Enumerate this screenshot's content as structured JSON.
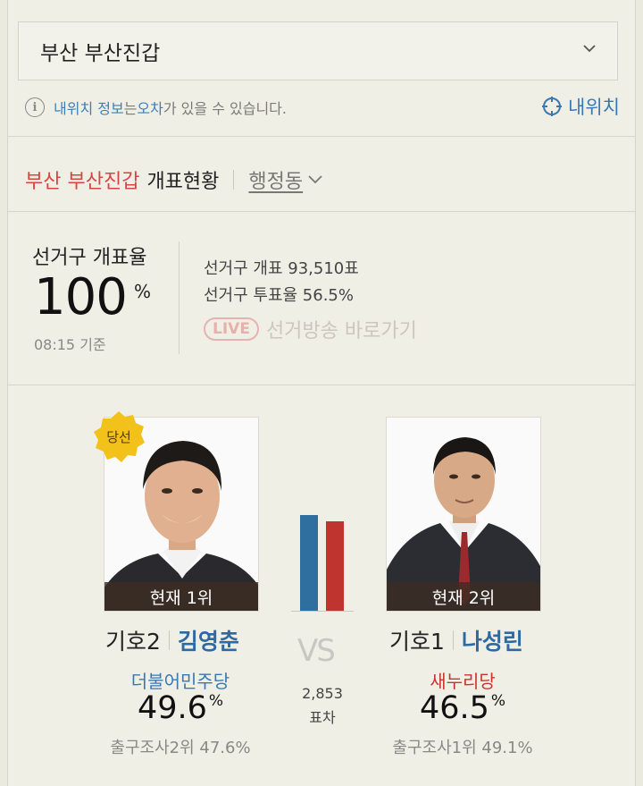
{
  "region_select": {
    "value": "부산 부산진갑"
  },
  "notice": {
    "blue_part1": "내위치 정보",
    "text_part1": "는 ",
    "blue_part2": "오차",
    "text_part2": "가 있을 수 있습니다."
  },
  "my_location": {
    "label": "내위치"
  },
  "header": {
    "region": "부산 부산진갑",
    "title": "개표현황",
    "dong_label": "행정동"
  },
  "rate": {
    "label": "선거구 개표율",
    "value": "100",
    "unit": "%",
    "time": "08:15 기준",
    "stat1": "선거구 개표  93,510표",
    "stat2": "선거구 투표율  56.5%",
    "live_badge": "LIVE",
    "live_text": "선거방송 바로가기"
  },
  "candidates": [
    {
      "rank": "현재 1위",
      "number": "기호2",
      "name": "김영춘",
      "party": "더불어민주당",
      "party_color": "#3a78b3",
      "pct": "49.6",
      "pct_unit": "%",
      "exit_poll": "출구조사2위 47.6%",
      "winner_badge": "당선"
    },
    {
      "rank": "현재 2위",
      "number": "기호1",
      "name": "나성린",
      "party": "새누리당",
      "party_color": "#c8352f",
      "pct": "46.5",
      "pct_unit": "%",
      "exit_poll": "출구조사1위 49.1%"
    }
  ],
  "versus": {
    "label": "VS",
    "diff": "2,853",
    "diff_unit": "표차"
  },
  "colors": {
    "blue_bar": "#2f6f9f",
    "red_bar": "#c0342f",
    "accent_red": "#d64541",
    "accent_blue": "#2d6aa3"
  }
}
